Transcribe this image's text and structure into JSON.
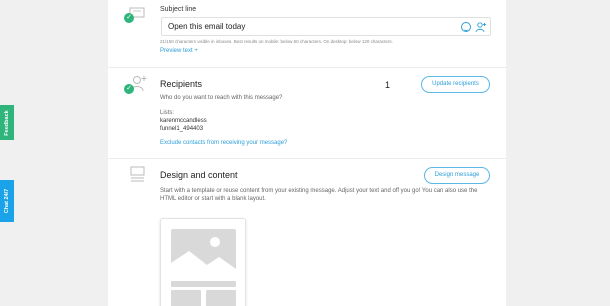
{
  "subject": {
    "label": "Subject line",
    "value": "Open this email today",
    "hint": "21/150 characters visible in inboxes. Best results on mobile: below 60 characters. On desktop: below 120 characters.",
    "preview_link": "Preview text +"
  },
  "recipients": {
    "title": "Recipients",
    "count": "1",
    "button": "Update recipients",
    "description": "Who do you want to reach with this message?",
    "lists_label": "Lists:",
    "lists": [
      "karenmccandless",
      "funnel1_494403"
    ],
    "exclude_link": "Exclude contacts from receiving your message?"
  },
  "design": {
    "title": "Design and content",
    "button": "Design message",
    "description": "Start with a template or reuse content from your existing message. Adjust your text and off you go! You can also use the HTML editor or start with a blank layout."
  },
  "side_tabs": {
    "feedback": "Feedback",
    "chat": "Chat 24/7"
  },
  "colors": {
    "accent": "#2e9fd8",
    "success": "#2fb47c",
    "chat": "#1aa3e8"
  }
}
